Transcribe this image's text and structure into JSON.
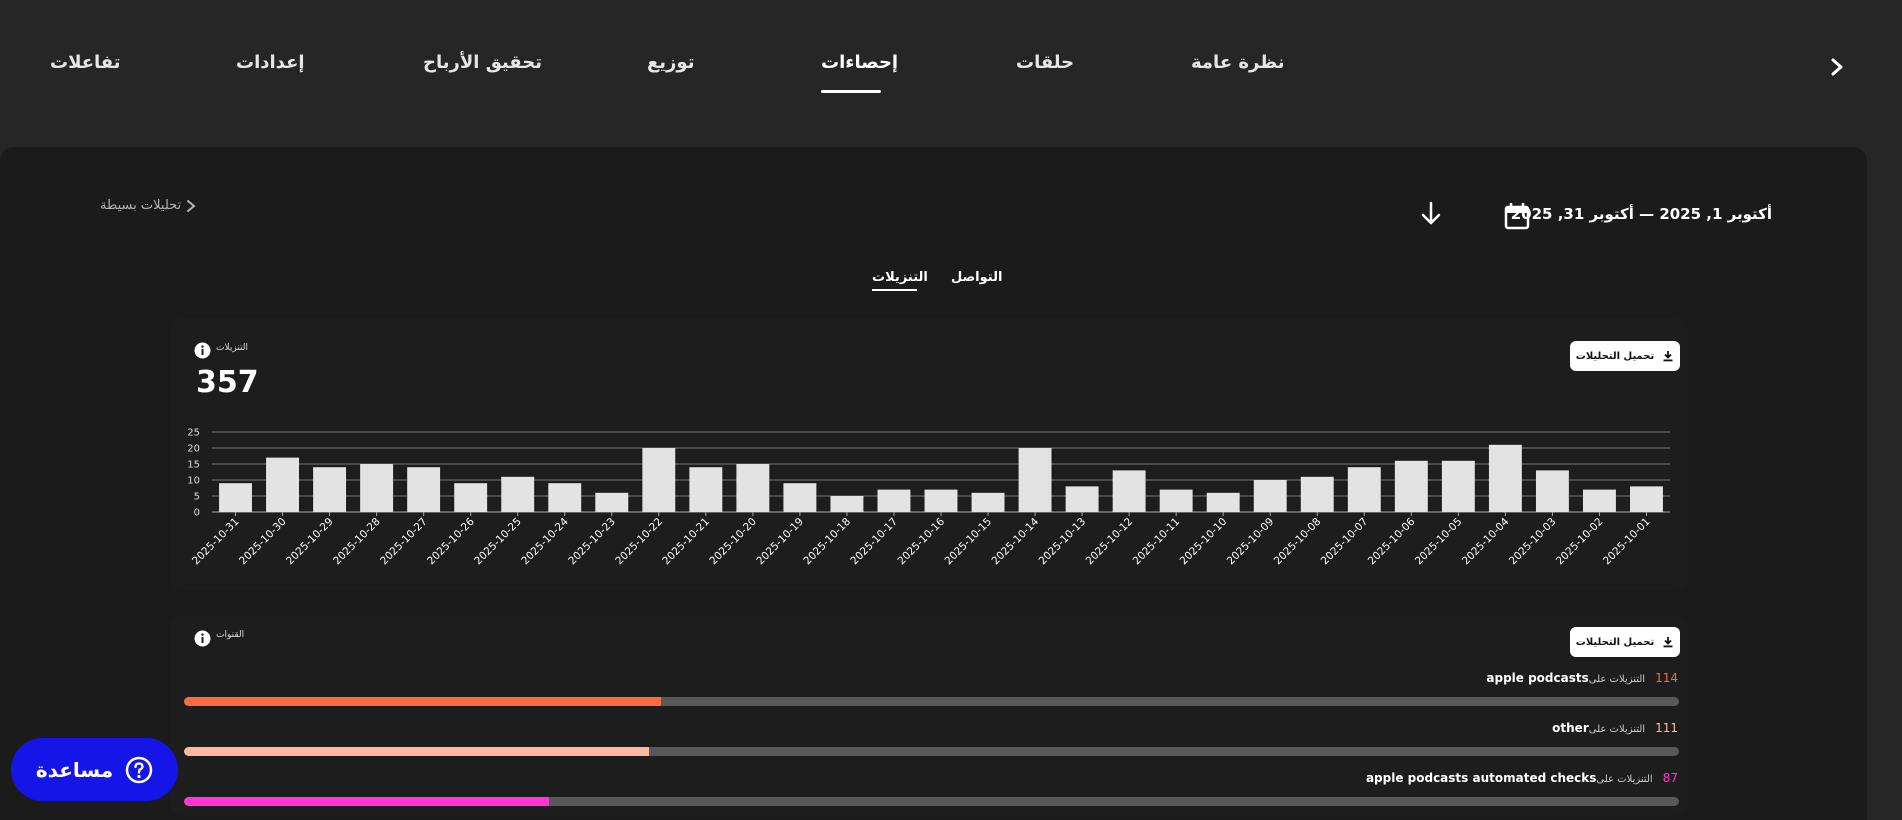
{
  "nav": {
    "tabs": [
      {
        "label": "نظرة عامة"
      },
      {
        "label": "حلقات"
      },
      {
        "label": "إحصاءات"
      },
      {
        "label": "توزيع"
      },
      {
        "label": "تحقيق الأرباح"
      },
      {
        "label": "إعدادات"
      },
      {
        "label": "تفاعلات"
      }
    ],
    "active_tab": "إحصاءات",
    "next_icon": "chevron-right-icon"
  },
  "header": {
    "date_range": "أكتوبر 1, 2025 — أكتوبر 31, 2025",
    "calendar_icon": "calendar-icon",
    "download_icon": "arrow-down-icon",
    "simple_analytics": "تحليلات بسيطة"
  },
  "subtabs": {
    "engagement": "التواصل",
    "downloads": "التنزيلات",
    "active": "التنزيلات"
  },
  "downloads_card": {
    "label": "التنزيلات",
    "total": "357",
    "download_button": "تحميل التحليلات"
  },
  "chart_data": {
    "type": "bar",
    "categories": [
      "2025-10-31",
      "2025-10-30",
      "2025-10-29",
      "2025-10-28",
      "2025-10-27",
      "2025-10-26",
      "2025-10-25",
      "2025-10-24",
      "2025-10-23",
      "2025-10-22",
      "2025-10-21",
      "2025-10-20",
      "2025-10-19",
      "2025-10-18",
      "2025-10-17",
      "2025-10-16",
      "2025-10-15",
      "2025-10-14",
      "2025-10-13",
      "2025-10-12",
      "2025-10-11",
      "2025-10-10",
      "2025-10-09",
      "2025-10-08",
      "2025-10-07",
      "2025-10-06",
      "2025-10-05",
      "2025-10-04",
      "2025-10-03",
      "2025-10-02",
      "2025-10-01"
    ],
    "values": [
      9,
      17,
      14,
      15,
      14,
      9,
      11,
      9,
      6,
      20,
      14,
      15,
      9,
      5,
      7,
      7,
      6,
      20,
      8,
      13,
      7,
      6,
      10,
      11,
      14,
      16,
      16,
      21,
      13,
      7,
      8
    ],
    "yticks": [
      0,
      5,
      10,
      15,
      20,
      25
    ],
    "ylim": [
      0,
      25
    ],
    "grid": true,
    "bar_color": "#e3e3e3"
  },
  "channels_card": {
    "label": "القنوات",
    "download_button": "تحميل التحليلات",
    "prefix": "التنزيلات على",
    "sources": [
      {
        "name": "apple podcasts",
        "count": 114,
        "percent": 31.9,
        "color": "#ff6a3d"
      },
      {
        "name": "other",
        "count": 111,
        "percent": 31.1,
        "color": "#ffb8a0"
      },
      {
        "name": "apple podcasts automated checks",
        "count": 87,
        "percent": 24.4,
        "color": "#ff35d4"
      }
    ]
  },
  "help": {
    "label": "مساعدة",
    "icon": "question-circle-icon"
  }
}
